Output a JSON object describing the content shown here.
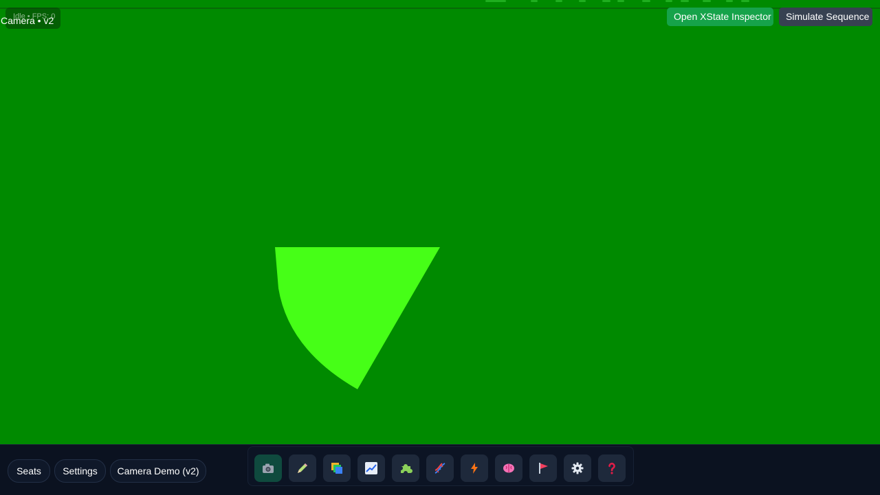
{
  "status": {
    "text": "Idle • FPS: 0"
  },
  "camera": {
    "title": "Camera • v2"
  },
  "actions": {
    "inspector_label": "Open XState Inspector",
    "simulate_label": "Simulate Sequence"
  },
  "scene": {
    "background_color": "#008a00",
    "shape_color": "#46ff17",
    "shape": "fan-sector"
  },
  "bottom": {
    "seats_label": "Seats",
    "settings_label": "Settings",
    "demo_label": "Camera Demo (v2)"
  },
  "toolbar": {
    "tools": [
      {
        "icon": "camera-icon",
        "active": true
      },
      {
        "icon": "pencil-icon",
        "active": false
      },
      {
        "icon": "layers-icon",
        "active": false
      },
      {
        "icon": "chart-icon",
        "active": false
      },
      {
        "icon": "puzzle-icon",
        "active": false
      },
      {
        "icon": "dna-icon",
        "active": false
      },
      {
        "icon": "lightning-icon",
        "active": false
      },
      {
        "icon": "brain-icon",
        "active": false
      },
      {
        "icon": "flag-icon",
        "active": false
      },
      {
        "icon": "gear-icon",
        "active": false
      },
      {
        "icon": "help-icon",
        "active": false
      }
    ]
  }
}
